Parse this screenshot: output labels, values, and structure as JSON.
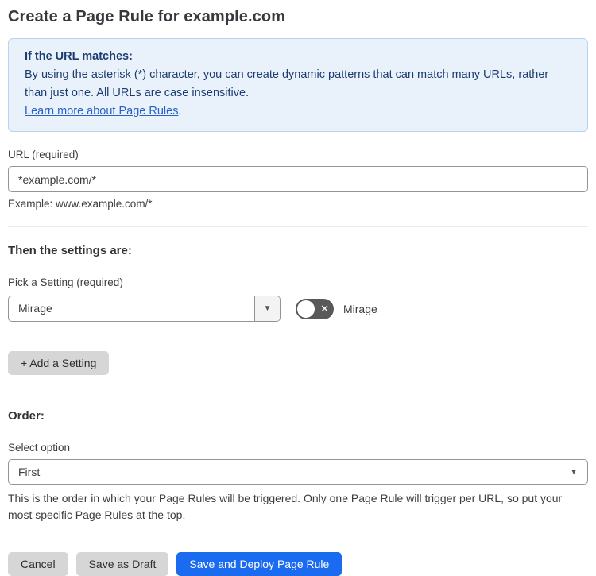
{
  "page": {
    "title": "Create a Page Rule for example.com"
  },
  "info_box": {
    "heading": "If the URL matches:",
    "body": "By using the asterisk (*) character, you can create dynamic patterns that can match many URLs, rather than just one. All URLs are case insensitive.",
    "link_label": "Learn more about Page Rules",
    "link_suffix": "."
  },
  "url_field": {
    "label": "URL (required)",
    "value": "*example.com/*",
    "helper": "Example: www.example.com/*"
  },
  "settings_section": {
    "heading": "Then the settings are:",
    "setting_label": "Pick a Setting (required)",
    "setting_value": "Mirage",
    "caret_icon": "▼",
    "toggle_state": "off",
    "toggle_x_icon": "✕",
    "toggle_label": "Mirage",
    "add_setting_label": "+ Add a Setting"
  },
  "order_section": {
    "heading": "Order:",
    "select_label": "Select option",
    "select_value": "First",
    "caret_icon": "▼",
    "helper": "This is the order in which your Page Rules will be triggered. Only one Page Rule will trigger per URL, so put your most specific Page Rules at the top."
  },
  "footer": {
    "cancel_label": "Cancel",
    "save_draft_label": "Save as Draft",
    "save_deploy_label": "Save and Deploy Page Rule"
  },
  "colors": {
    "info_bg": "#e9f1fb",
    "info_border": "#b9d4ee",
    "info_text": "#1d3c6f",
    "link_blue": "#2a61c9",
    "primary_blue": "#1a6bf0",
    "button_gray": "#d6d6d6",
    "toggle_gray": "#595959"
  }
}
